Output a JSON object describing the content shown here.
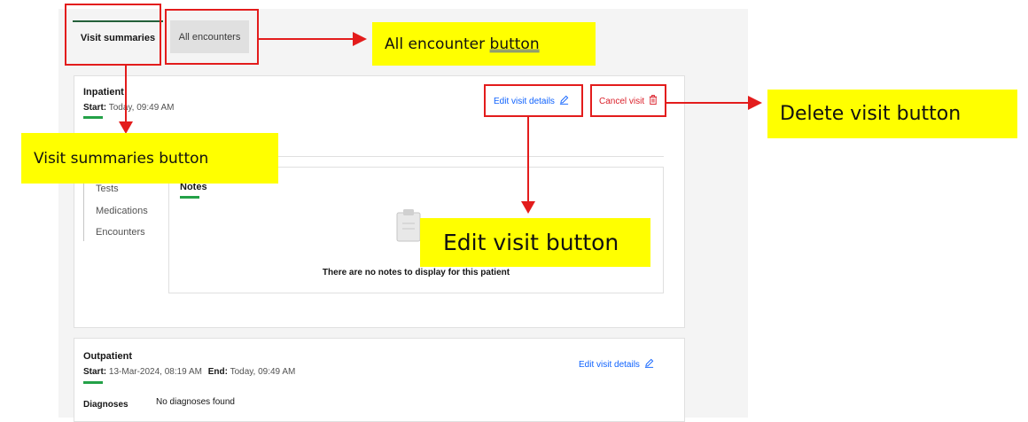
{
  "tabs": {
    "visit_summaries": "Visit summaries",
    "all_encounters": "All encounters"
  },
  "visit1": {
    "type": "Inpatient",
    "start_label": "Start:",
    "start_value": "Today, 09:49 AM",
    "edit_label": "Edit visit details",
    "cancel_label": "Cancel visit",
    "nav": [
      "Tests",
      "Medications",
      "Encounters"
    ],
    "notes_title": "Notes",
    "empty_text": "There are no notes to display for this patient"
  },
  "visit2": {
    "type": "Outpatient",
    "start_label": "Start:",
    "start_value": "13-Mar-2024, 08:19 AM",
    "end_label": "End:",
    "end_value": "Today, 09:49 AM",
    "edit_label": "Edit visit details",
    "diagnoses_label": "Diagnoses",
    "diagnoses_value": "No diagnoses found"
  },
  "annotations": {
    "all_encounter_prefix": "All encounter ",
    "all_encounter_underlined": "button",
    "delete_visit": "Delete visit button",
    "visit_summaries": "Visit summaries button",
    "edit_visit": "Edit visit button"
  },
  "colors": {
    "annotation_red": "#e31c1c",
    "callout_yellow": "#ffff00",
    "accent_green": "#24a148",
    "link_blue": "#0f62fe"
  },
  "icons": {
    "edit": "pencil-icon",
    "cancel": "trash-icon",
    "empty_state": "clipboard-icon"
  }
}
